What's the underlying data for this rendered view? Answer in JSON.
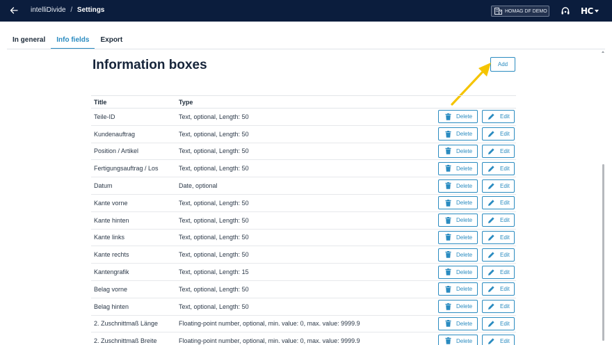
{
  "header": {
    "app_name": "intelliDivide",
    "separator": "/",
    "current_page": "Settings",
    "company": "HOMAG DF DEMO",
    "logo_text": "HC"
  },
  "tabs": [
    {
      "label": "In general",
      "active": false
    },
    {
      "label": "Info fields",
      "active": true
    },
    {
      "label": "Export",
      "active": false
    }
  ],
  "main": {
    "title": "Information boxes",
    "add_label": "Add"
  },
  "table": {
    "columns": [
      "Title",
      "Type"
    ],
    "delete_label": "Delete",
    "edit_label": "Edit",
    "rows": [
      {
        "title": "Teile-ID",
        "type": "Text, optional, Length: 50"
      },
      {
        "title": "Kundenauftrag",
        "type": "Text, optional, Length: 50"
      },
      {
        "title": "Position / Artikel",
        "type": "Text, optional, Length: 50"
      },
      {
        "title": "Fertigungsauftrag / Los",
        "type": "Text, optional, Length: 50"
      },
      {
        "title": "Datum",
        "type": "Date, optional"
      },
      {
        "title": "Kante vorne",
        "type": "Text, optional, Length: 50"
      },
      {
        "title": "Kante hinten",
        "type": "Text, optional, Length: 50"
      },
      {
        "title": "Kante links",
        "type": "Text, optional, Length: 50"
      },
      {
        "title": "Kante rechts",
        "type": "Text, optional, Length: 50"
      },
      {
        "title": "Kantengrafik",
        "type": "Text, optional, Length: 15"
      },
      {
        "title": "Belag vorne",
        "type": "Text, optional, Length: 50"
      },
      {
        "title": "Belag hinten",
        "type": "Text, optional, Length: 50"
      },
      {
        "title": "2. Zuschnittmaß Länge",
        "type": "Floating-point number, optional, min. value: 0, max. value: 9999.9"
      },
      {
        "title": "2. Zuschnittmaß Breite",
        "type": "Floating-point number, optional, min. value: 0, max. value: 9999.9"
      }
    ]
  },
  "colors": {
    "topbar": "#0b1d3d",
    "accent": "#2a8bc0",
    "annotation_arrow": "#f5c400"
  },
  "icons": {
    "back": "arrow-left-icon",
    "company": "building-icon",
    "support": "headset-icon",
    "delete": "trash-icon",
    "edit": "pencil-icon"
  }
}
